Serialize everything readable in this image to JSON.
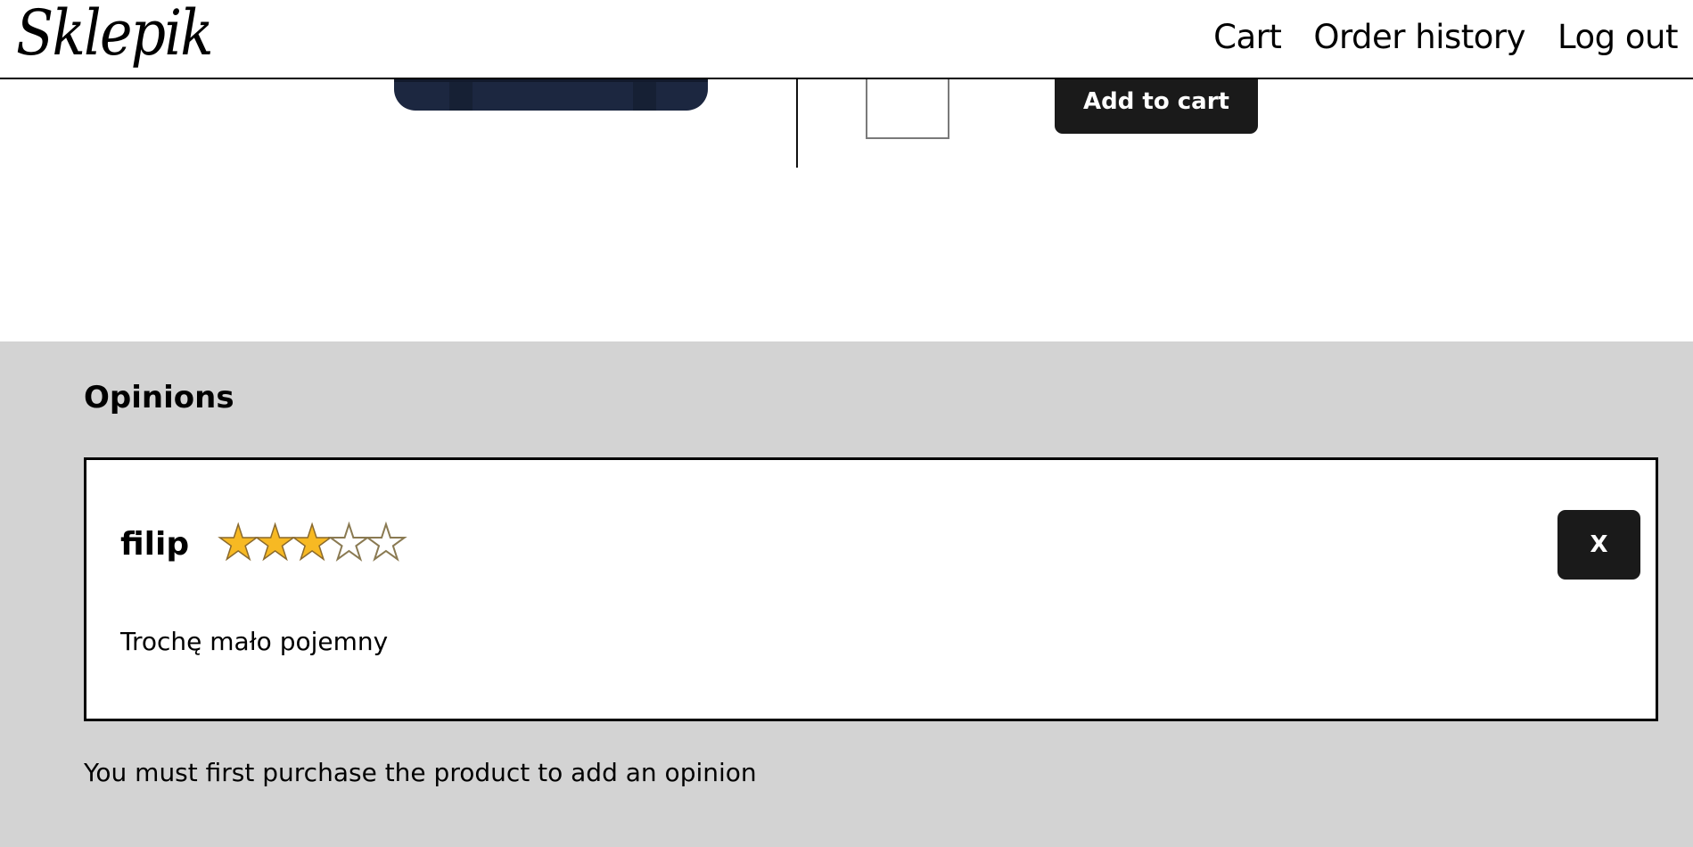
{
  "header": {
    "logo": "Sklepik",
    "nav": [
      {
        "label": "Cart"
      },
      {
        "label": "Order history"
      },
      {
        "label": "Log out"
      }
    ]
  },
  "product": {
    "add_to_cart_label": "Add to cart"
  },
  "opinions": {
    "title": "Opinions",
    "items": [
      {
        "author": "filip",
        "rating": 3,
        "max_rating": 5,
        "text": "Trochę mało pojemny",
        "delete_label": "X"
      }
    ],
    "purchase_note": "You must first purchase the product to add an opinion"
  },
  "colors": {
    "button_bg": "#1a1a1a",
    "section_bg": "#d3d3d3",
    "star_filled": "#f7b923"
  }
}
